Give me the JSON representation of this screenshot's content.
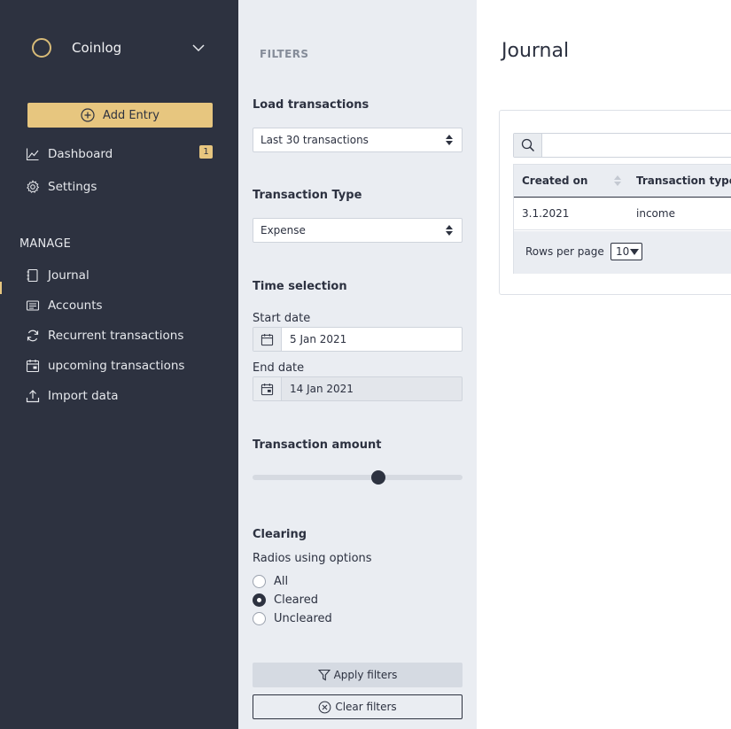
{
  "colors": {
    "sidebar_bg": "#2d3240",
    "accent": "#e7c67f",
    "panel_bg": "#eaedf2"
  },
  "sidebar": {
    "app_name": "Coinlog",
    "add_entry_label": "Add Entry",
    "nav": [
      {
        "label": "Dashboard",
        "icon": "chart-line-icon",
        "badge": "1"
      },
      {
        "label": "Settings",
        "icon": "gear-icon"
      }
    ],
    "manage_heading": "MANAGE",
    "manage_items": [
      {
        "label": "Journal",
        "icon": "notebook-icon"
      },
      {
        "label": "Accounts",
        "icon": "list-card-icon"
      },
      {
        "label": "Recurrent transactions",
        "icon": "refresh-icon"
      },
      {
        "label": "upcoming transactions",
        "icon": "calendar-icon"
      },
      {
        "label": "Import data",
        "icon": "upload-icon"
      }
    ]
  },
  "filters": {
    "title": "FILTERS",
    "load_label": "Load transactions",
    "load_value": "Last 30 transactions",
    "type_label": "Transaction Type",
    "type_value": "Expense",
    "time_label": "Time selection",
    "start_label": "Start date",
    "start_value": "5 Jan 2021",
    "end_label": "End date",
    "end_value": "14 Jan 2021",
    "amount_label": "Transaction amount",
    "amount_fraction": 0.6,
    "clearing_label": "Clearing",
    "radios_caption": "Radios using options",
    "radio_options": [
      "All",
      "Cleared",
      "Uncleared"
    ],
    "radio_selected": "Cleared",
    "apply_label": "Apply filters",
    "clear_label": "Clear filters"
  },
  "main": {
    "title": "Journal",
    "search_placeholder": "",
    "columns": [
      "Created on",
      "Transaction type"
    ],
    "rows": [
      {
        "created_on": "3.1.2021",
        "transaction_type": "income"
      }
    ],
    "rows_per_page_label": "Rows per page",
    "rows_per_page_value": "10"
  }
}
